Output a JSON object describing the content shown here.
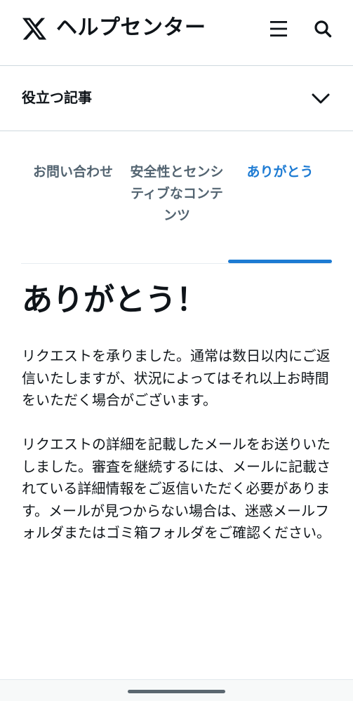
{
  "header": {
    "title": "ヘルプセンター",
    "logo_icon": "x-logo-icon",
    "menu_icon": "hamburger-menu-icon",
    "search_icon": "search-icon"
  },
  "accordion": {
    "label": "役立つ記事",
    "icon": "chevron-down-icon"
  },
  "tabs": [
    {
      "label": "お問い合わせ",
      "active": false
    },
    {
      "label": "安全性とセンシティブなコンテンツ",
      "active": false
    },
    {
      "label": "ありがとう",
      "active": true
    }
  ],
  "main": {
    "title": "ありがとう！",
    "paragraphs": [
      "リクエストを承りました。通常は数日以内にご返信いたしますが、状況によってはそれ以上お時間をいただく場合がございます。",
      "リクエストの詳細を記載したメールをお送りいたしました。審査を継続するには、メールに記載されている詳細情報をご返信いただく必要があります。メールが見つからない場合は、迷惑メールフォルダまたはゴミ箱フォルダをご確認ください。"
    ]
  },
  "colors": {
    "accent": "#1d7bd3",
    "text": "#0f1419",
    "muted": "#536471"
  }
}
